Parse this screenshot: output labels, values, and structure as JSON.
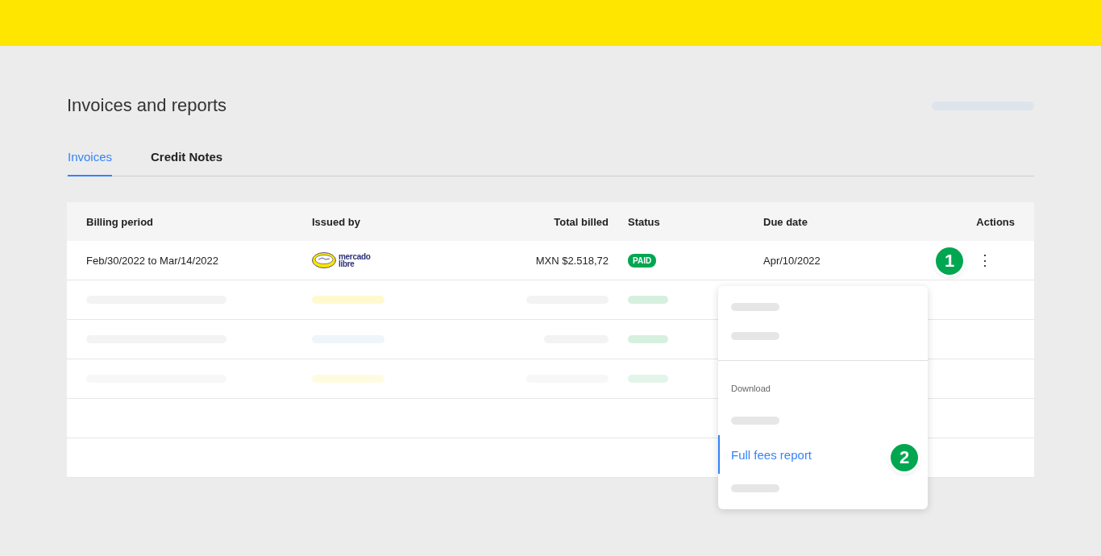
{
  "page": {
    "title": "Invoices and reports"
  },
  "tabs": [
    {
      "label": "Invoices",
      "selected": true
    },
    {
      "label": "Credit Notes",
      "selected": false
    }
  ],
  "table": {
    "columns": [
      "Billing period",
      "Issued by",
      "Total billed",
      "Status",
      "Due date",
      "Actions"
    ],
    "rows": [
      {
        "billing_period": "Feb/30/2022 to Mar/14/2022",
        "issued_by": {
          "logo_line_1": "mercado",
          "logo_line_2": "libre"
        },
        "total_billed": "MXN $2.518,72",
        "status": "PAID",
        "due_date": "Apr/10/2022",
        "actions": "⋮"
      }
    ],
    "placeholder_rows": [
      {},
      {},
      {}
    ]
  },
  "menu": {
    "section_label": "Download",
    "items": [
      {
        "kind": "skeleton"
      },
      {
        "kind": "skeleton"
      },
      {
        "kind": "divider"
      },
      {
        "kind": "heading"
      },
      {
        "kind": "skeleton"
      },
      {
        "kind": "link",
        "label": "Full fees report",
        "selected": true
      },
      {
        "kind": "skeleton"
      }
    ]
  },
  "markers": [
    "1",
    "2"
  ]
}
